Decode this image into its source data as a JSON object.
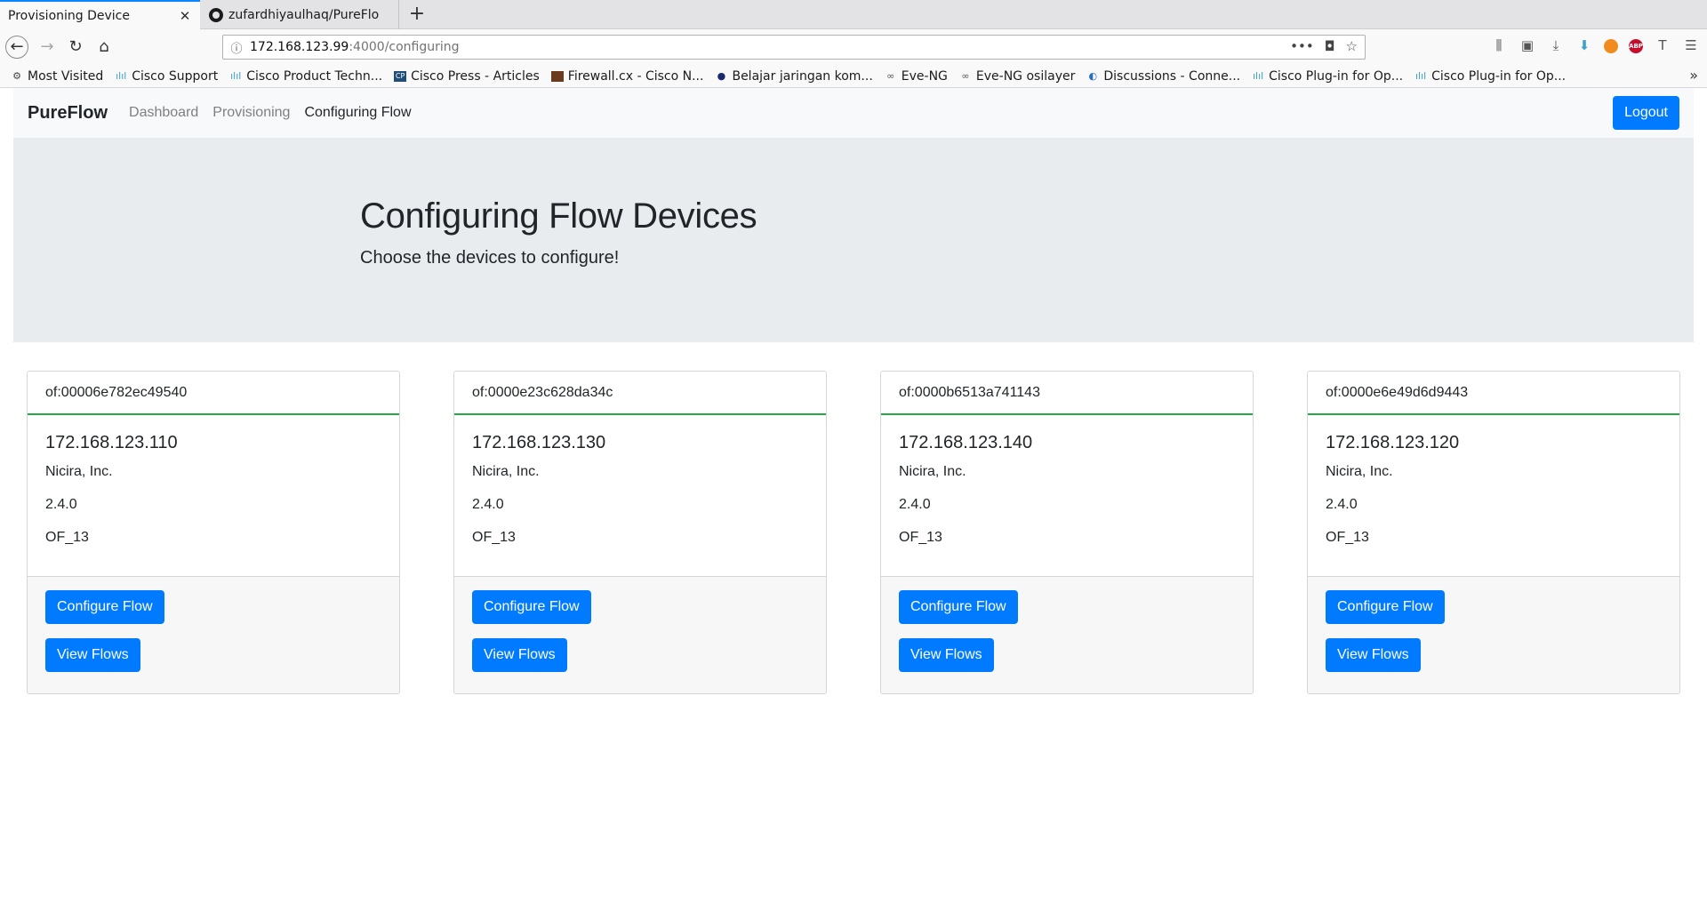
{
  "browser": {
    "tabs": [
      {
        "title": "Provisioning Device",
        "close": "✕"
      },
      {
        "title": "zufardhiyaulhaq/PureFlo"
      }
    ],
    "new_tab": "+",
    "url": {
      "host": "172.168.123.99",
      "path": ":4000/configuring"
    },
    "bookmarks": [
      {
        "label": "Most Visited",
        "icon": "gear-icon"
      },
      {
        "label": "Cisco Support",
        "icon": "cisco-icon"
      },
      {
        "label": "Cisco Product Techn...",
        "icon": "cisco-icon"
      },
      {
        "label": "Cisco Press - Articles",
        "icon": "cp-icon"
      },
      {
        "label": "Firewall.cx - Cisco N...",
        "icon": "firewall-icon"
      },
      {
        "label": "Belajar jaringan kom...",
        "icon": "globe-icon"
      },
      {
        "label": "Eve-NG",
        "icon": "eve-icon"
      },
      {
        "label": "Eve-NG osilayer",
        "icon": "eve-icon"
      },
      {
        "label": "Discussions - Conne...",
        "icon": "discussion-icon"
      },
      {
        "label": "Cisco Plug-in for Op...",
        "icon": "cisco-icon"
      },
      {
        "label": "Cisco Plug-in for Op...",
        "icon": "cisco-icon"
      }
    ]
  },
  "app": {
    "brand": "PureFlow",
    "nav": [
      "Dashboard",
      "Provisioning",
      "Configuring Flow"
    ],
    "logout": "Logout"
  },
  "hero": {
    "title": "Configuring Flow Devices",
    "subtitle": "Choose the devices to configure!"
  },
  "devices": [
    {
      "id": "of:00006e782ec49540",
      "ip": "172.168.123.110",
      "vendor": "Nicira, Inc.",
      "version": "2.4.0",
      "protocol": "OF_13"
    },
    {
      "id": "of:0000e23c628da34c",
      "ip": "172.168.123.130",
      "vendor": "Nicira, Inc.",
      "version": "2.4.0",
      "protocol": "OF_13"
    },
    {
      "id": "of:0000b6513a741143",
      "ip": "172.168.123.140",
      "vendor": "Nicira, Inc.",
      "version": "2.4.0",
      "protocol": "OF_13"
    },
    {
      "id": "of:0000e6e49d6d9443",
      "ip": "172.168.123.120",
      "vendor": "Nicira, Inc.",
      "version": "2.4.0",
      "protocol": "OF_13"
    }
  ],
  "buttons": {
    "configure": "Configure Flow",
    "view": "View Flows"
  },
  "colors": {
    "primary": "#007bff",
    "success": "#28a745",
    "jumbotron": "#e9ecef",
    "navbar": "#f8f9fa"
  }
}
